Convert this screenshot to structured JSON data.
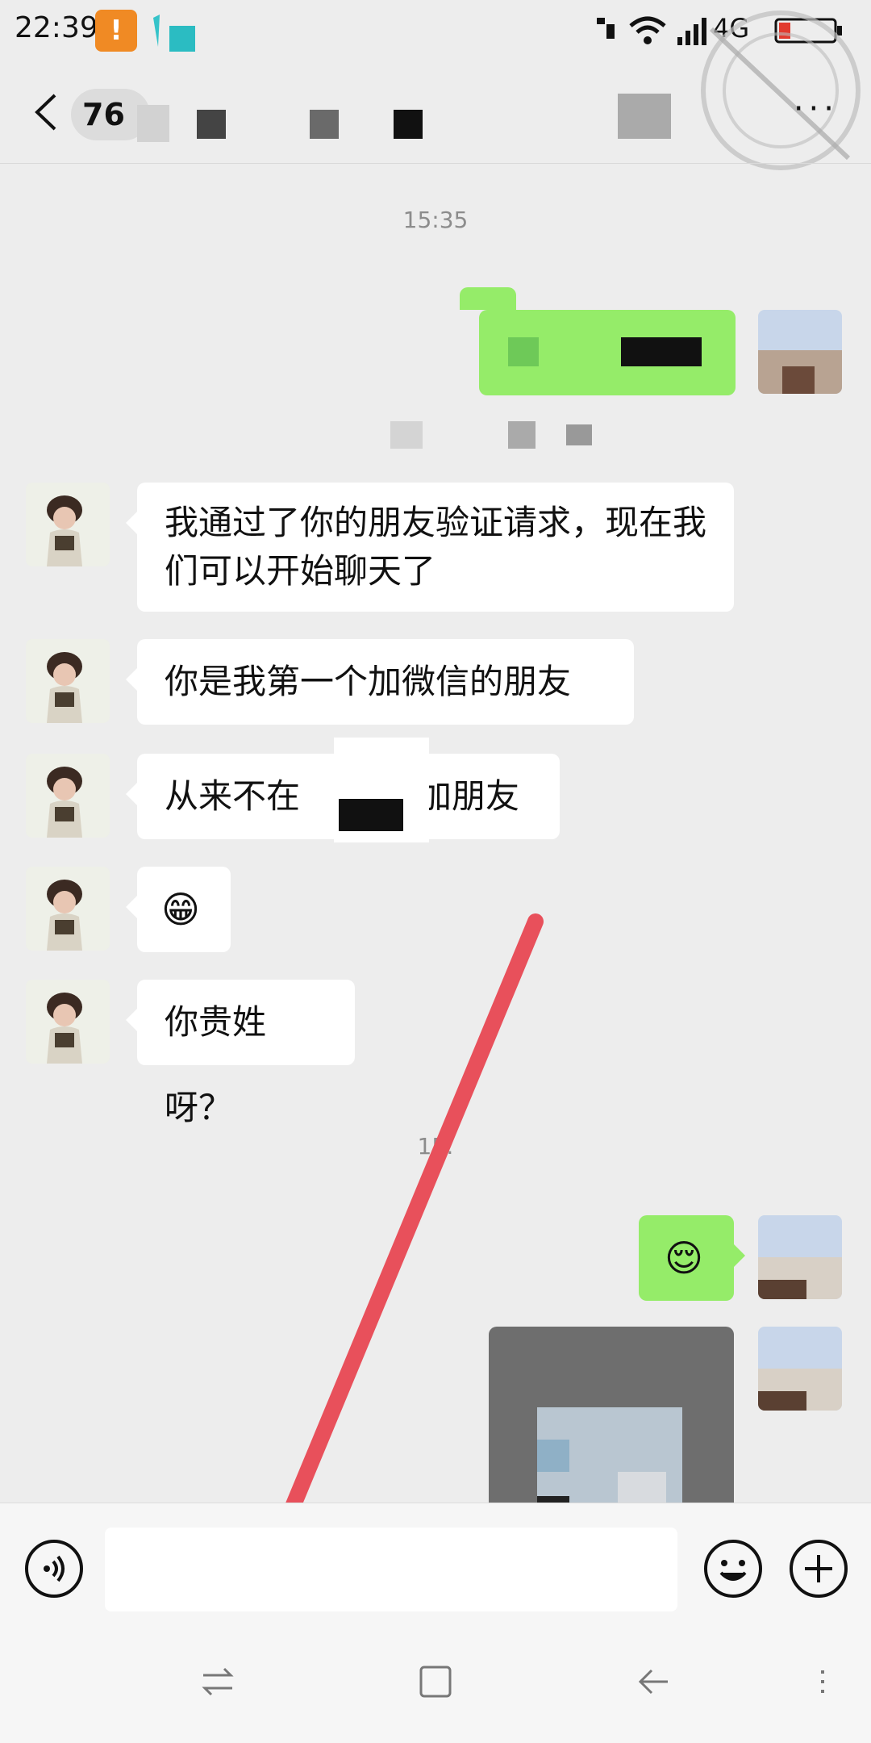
{
  "status": {
    "time": "22:39",
    "network": "4G"
  },
  "header": {
    "count": "76"
  },
  "chat": {
    "timestamp1": "15:35",
    "timestamp2": "15:",
    "messages": [
      {
        "text": "我通过了你的朋友验证请求，现在我们可以开始聊天了"
      },
      {
        "text": "你是我第一个加微信的朋友"
      },
      {
        "text": "从来不在",
        "text_tail": "上加朋友"
      },
      {
        "emoji": "😁"
      },
      {
        "text": "你贵姓呀？"
      },
      {
        "emoji": "😌"
      }
    ]
  },
  "icons": {
    "back": "chevron-left-icon",
    "voice": "voice-icon",
    "emoji": "smile-icon",
    "plus": "plus-icon"
  },
  "colors": {
    "self_bubble": "#95ec69",
    "bg": "#ededed",
    "annotation": "#e8505b"
  }
}
